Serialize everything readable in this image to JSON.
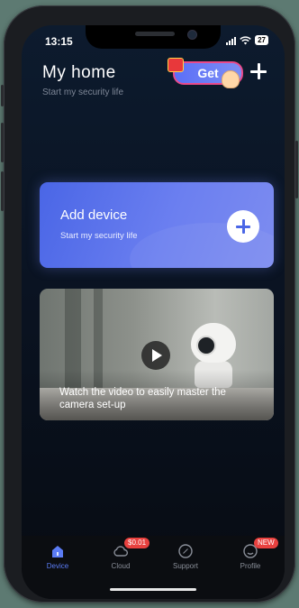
{
  "status_bar": {
    "time": "13:15",
    "battery": "27"
  },
  "header": {
    "title": "My home",
    "subtitle": "Start my security life",
    "promo_label": "Get"
  },
  "add_device": {
    "title": "Add device",
    "subtitle": "Start my security life"
  },
  "video_card": {
    "caption": "Watch the video to easily master the camera set-up"
  },
  "tabs": [
    {
      "label": "Device",
      "active": true
    },
    {
      "label": "Cloud",
      "badge": "$0.01"
    },
    {
      "label": "Support"
    },
    {
      "label": "Profile",
      "badge": "NEW"
    }
  ],
  "colors": {
    "accent": "#5b7cf5",
    "badge_red": "#e8413f",
    "card_blue": "#4a66e6"
  }
}
